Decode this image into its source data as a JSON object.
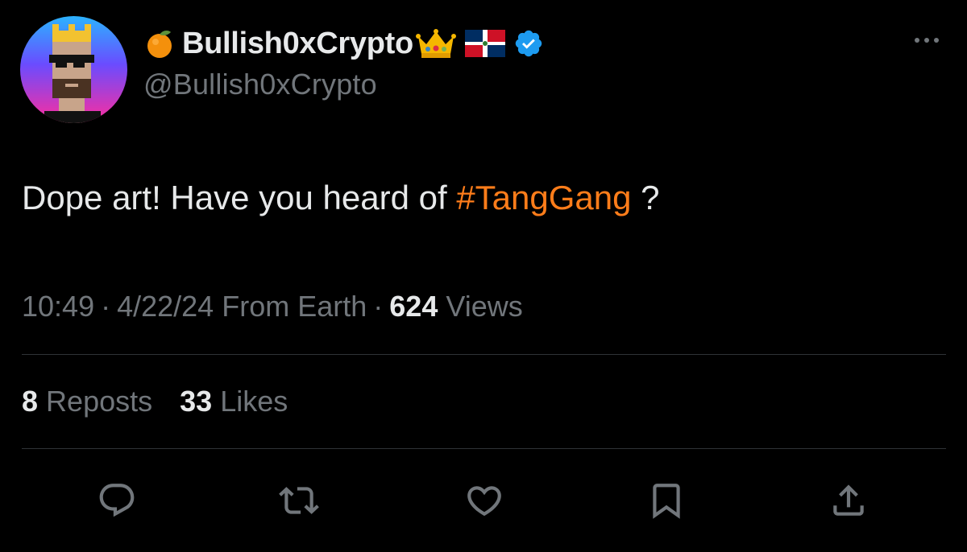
{
  "author": {
    "display_name": "Bullish0xCrypto",
    "handle": "@Bullish0xCrypto",
    "leading_emoji": "tangerine-emoji",
    "trailing_emojis": [
      "crown-emoji",
      "dominican-republic-flag-emoji"
    ],
    "verified_badge": "verified-badge-icon",
    "verified_color": "#1d9bf0"
  },
  "tweet": {
    "text_before": "Dope art! Have you heard of ",
    "hashtag": "#TangGang",
    "text_after": " ?",
    "hashtag_color": "#ff7d1a"
  },
  "meta": {
    "time": "10:49",
    "separator": "·",
    "date": "4/22/24",
    "location": "From Earth",
    "views_count": "624",
    "views_label": "Views"
  },
  "stats": {
    "reposts_count": "8",
    "reposts_label": "Reposts",
    "likes_count": "33",
    "likes_label": "Likes"
  },
  "actions": [
    "reply-icon",
    "repost-icon",
    "like-icon",
    "bookmark-icon",
    "share-icon"
  ],
  "colors": {
    "background": "#000000",
    "primary_text": "#e7e9ea",
    "secondary_text": "#71767b",
    "divider": "#2f3336"
  }
}
